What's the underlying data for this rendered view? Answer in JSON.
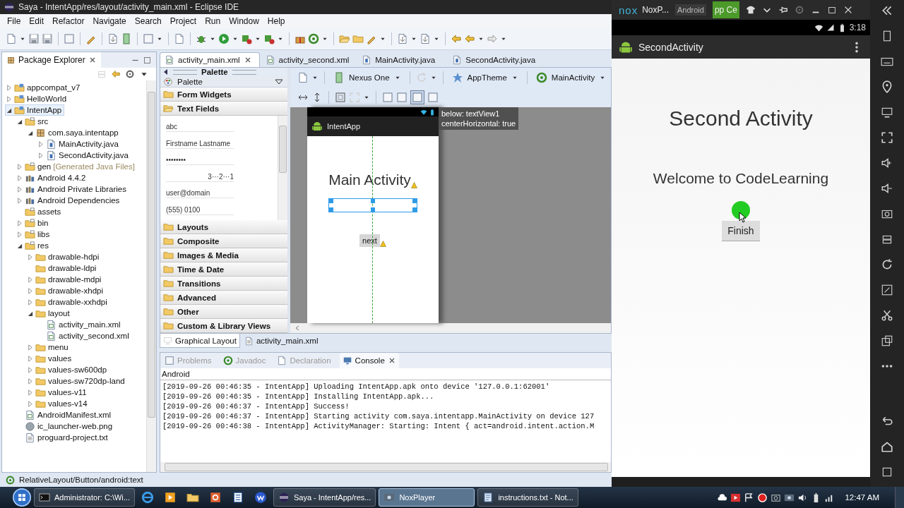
{
  "eclipse": {
    "title": "Saya - IntentApp/res/layout/activity_main.xml - Eclipse IDE",
    "menu": [
      "File",
      "Edit",
      "Refactor",
      "Navigate",
      "Search",
      "Project",
      "Run",
      "Window",
      "Help"
    ],
    "package_explorer": {
      "title": "Package Explorer",
      "tree": [
        {
          "label": "appcompat_v7",
          "kind": "project",
          "expanded": false,
          "selected": false
        },
        {
          "label": "HelloWorld",
          "kind": "project",
          "expanded": false,
          "selected": false
        },
        {
          "label": "IntentApp",
          "kind": "project",
          "expanded": true,
          "selected": true,
          "children": [
            {
              "label": "src",
              "kind": "src",
              "expanded": true,
              "selected": false,
              "children": [
                {
                  "label": "com.saya.intentapp",
                  "kind": "package",
                  "expanded": true,
                  "selected": false,
                  "children": [
                    {
                      "label": "MainActivity.java",
                      "kind": "java",
                      "expanded": false,
                      "selected": false
                    },
                    {
                      "label": "SecondActivity.java",
                      "kind": "java",
                      "expanded": false,
                      "selected": false
                    }
                  ]
                }
              ]
            },
            {
              "label": "gen",
              "note": "[Generated Java Files]",
              "kind": "src",
              "expanded": false,
              "selected": false
            },
            {
              "label": "Android 4.4.2",
              "kind": "library",
              "expanded": false,
              "selected": false
            },
            {
              "label": "Android Private Libraries",
              "kind": "library",
              "expanded": false,
              "selected": false
            },
            {
              "label": "Android Dependencies",
              "kind": "library",
              "expanded": false,
              "selected": false
            },
            {
              "label": "assets",
              "kind": "src",
              "selected": false
            },
            {
              "label": "bin",
              "kind": "src",
              "expanded": false,
              "selected": false
            },
            {
              "label": "libs",
              "kind": "src",
              "expanded": false,
              "selected": false
            },
            {
              "label": "res",
              "kind": "src",
              "expanded": true,
              "selected": false,
              "children": [
                {
                  "label": "drawable-hdpi",
                  "kind": "folder",
                  "expanded": false,
                  "selected": false
                },
                {
                  "label": "drawable-ldpi",
                  "kind": "folder",
                  "selected": false
                },
                {
                  "label": "drawable-mdpi",
                  "kind": "folder",
                  "expanded": false,
                  "selected": false
                },
                {
                  "label": "drawable-xhdpi",
                  "kind": "folder",
                  "expanded": false,
                  "selected": false
                },
                {
                  "label": "drawable-xxhdpi",
                  "kind": "folder",
                  "expanded": false,
                  "selected": false
                },
                {
                  "label": "layout",
                  "kind": "folder",
                  "expanded": true,
                  "selected": false,
                  "children": [
                    {
                      "label": "activity_main.xml",
                      "kind": "xml",
                      "selected": false
                    },
                    {
                      "label": "activity_second.xml",
                      "kind": "xml",
                      "selected": false
                    }
                  ]
                },
                {
                  "label": "menu",
                  "kind": "folder",
                  "expanded": false,
                  "selected": false
                },
                {
                  "label": "values",
                  "kind": "folder",
                  "expanded": false,
                  "selected": false
                },
                {
                  "label": "values-sw600dp",
                  "kind": "folder",
                  "expanded": false,
                  "selected": false
                },
                {
                  "label": "values-sw720dp-land",
                  "kind": "folder",
                  "expanded": false,
                  "selected": false
                },
                {
                  "label": "values-v11",
                  "kind": "folder",
                  "expanded": false,
                  "selected": false
                },
                {
                  "label": "values-v14",
                  "kind": "folder",
                  "expanded": false,
                  "selected": false
                }
              ]
            },
            {
              "label": "AndroidManifest.xml",
              "kind": "xml",
              "selected": false
            },
            {
              "label": "ic_launcher-web.png",
              "kind": "image",
              "selected": false
            },
            {
              "label": "proguard-project.txt",
              "kind": "text",
              "selected": false
            }
          ]
        }
      ]
    },
    "editor_tabs": [
      {
        "label": "activity_main.xml",
        "kind": "xml",
        "selected": true
      },
      {
        "label": "activity_second.xml",
        "kind": "xml",
        "selected": false
      },
      {
        "label": "MainActivity.java",
        "kind": "java",
        "selected": false
      },
      {
        "label": "SecondActivity.java",
        "kind": "java",
        "selected": false
      }
    ],
    "palette": {
      "title": "Palette",
      "dropdown": "Palette",
      "categories": [
        {
          "label": "Form Widgets",
          "expanded": false
        },
        {
          "label": "Text Fields",
          "expanded": true,
          "items": [
            "abc",
            "Firstname Lastname",
            "••••••••",
            "3···2···1",
            "user@domain",
            "(555) 0100"
          ]
        },
        {
          "label": "Layouts",
          "expanded": false
        },
        {
          "label": "Composite",
          "expanded": false
        },
        {
          "label": "Images & Media",
          "expanded": false
        },
        {
          "label": "Time & Date",
          "expanded": false
        },
        {
          "label": "Transitions",
          "expanded": false
        },
        {
          "label": "Advanced",
          "expanded": false
        },
        {
          "label": "Other",
          "expanded": false
        },
        {
          "label": "Custom & Library Views",
          "expanded": false
        }
      ]
    },
    "layout_toolbar": {
      "device": "Nexus One",
      "theme": "AppTheme",
      "activity": "MainActivity"
    },
    "preview": {
      "app_title": "IntentApp",
      "heading": "Main Activity",
      "button": "next",
      "tooltip": [
        "below: textView1",
        "centerHorizontal: true"
      ]
    },
    "bottom_tabs": [
      {
        "label": "Graphical Layout",
        "selected": true
      },
      {
        "label": "activity_main.xml",
        "selected": false
      }
    ],
    "console": {
      "tabs": [
        {
          "label": "Problems",
          "kind": "problems",
          "selected": false
        },
        {
          "label": "Javadoc",
          "kind": "javadoc",
          "selected": false
        },
        {
          "label": "Declaration",
          "kind": "declaration",
          "selected": false
        },
        {
          "label": "Console",
          "kind": "console",
          "selected": true
        }
      ],
      "source": "Android",
      "lines": [
        "[2019-09-26 00:46:35 - IntentApp] Uploading IntentApp.apk onto device '127.0.0.1:62001'",
        "[2019-09-26 00:46:35 - IntentApp] Installing IntentApp.apk...",
        "[2019-09-26 00:46:37 - IntentApp] Success!",
        "[2019-09-26 00:46:37 - IntentApp] Starting activity com.saya.intentapp.MainActivity on device 127",
        "[2019-09-26 00:46:38 - IntentApp] ActivityManager: Starting: Intent { act=android.intent.action.M"
      ]
    },
    "status_bar": "RelativeLayout/Button/android:text"
  },
  "nox": {
    "logo": "nox",
    "title": "NoxP...",
    "system_badge": "Android",
    "app_center": "pp Ce",
    "time": "3:18",
    "app_title": "SecondActivity",
    "heading": "Second Activity",
    "message": "Welcome to CodeLearning",
    "button": "Finish"
  },
  "taskbar": {
    "tasks": [
      {
        "label": "Administrator: C:\\Wi...",
        "kind": "cmd",
        "selected": false
      },
      {
        "label": "Saya - IntentApp/res...",
        "kind": "eclipse",
        "selected": false
      },
      {
        "label": "NoxPlayer",
        "kind": "nox",
        "selected": true
      },
      {
        "label": "instructions.txt - Not...",
        "kind": "notepad",
        "selected": false
      }
    ],
    "clock": "12:47 AM"
  }
}
